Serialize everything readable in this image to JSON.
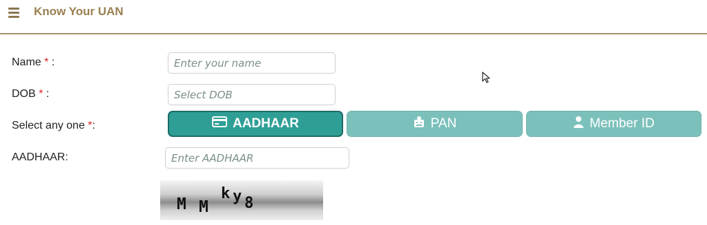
{
  "header": {
    "title": "Know Your UAN",
    "menu_icon": "hamburger-menu-icon"
  },
  "form": {
    "name": {
      "label": "Name",
      "required": "*",
      "colon": " :",
      "placeholder": "Enter your name",
      "value": ""
    },
    "dob": {
      "label": "DOB",
      "required": "*",
      "colon": " :",
      "placeholder": "Select DOB",
      "value": ""
    },
    "select": {
      "label": "Select any one ",
      "required": "*",
      "colon": ":",
      "options": [
        {
          "label": "AADHAAR",
          "icon": "id-card-icon",
          "selected": true
        },
        {
          "label": "PAN",
          "icon": "pan-card-icon",
          "selected": false
        },
        {
          "label": "Member ID",
          "icon": "user-icon",
          "selected": false
        }
      ]
    },
    "aadhaar": {
      "label": "AADHAAR:",
      "placeholder": "Enter AADHAAR",
      "value": ""
    },
    "captcha": {
      "text": "MMky8"
    }
  },
  "colors": {
    "accent": "#2f9f96",
    "accent_light": "#7cc0bb",
    "title": "#9a7f50",
    "required": "#d22222"
  }
}
